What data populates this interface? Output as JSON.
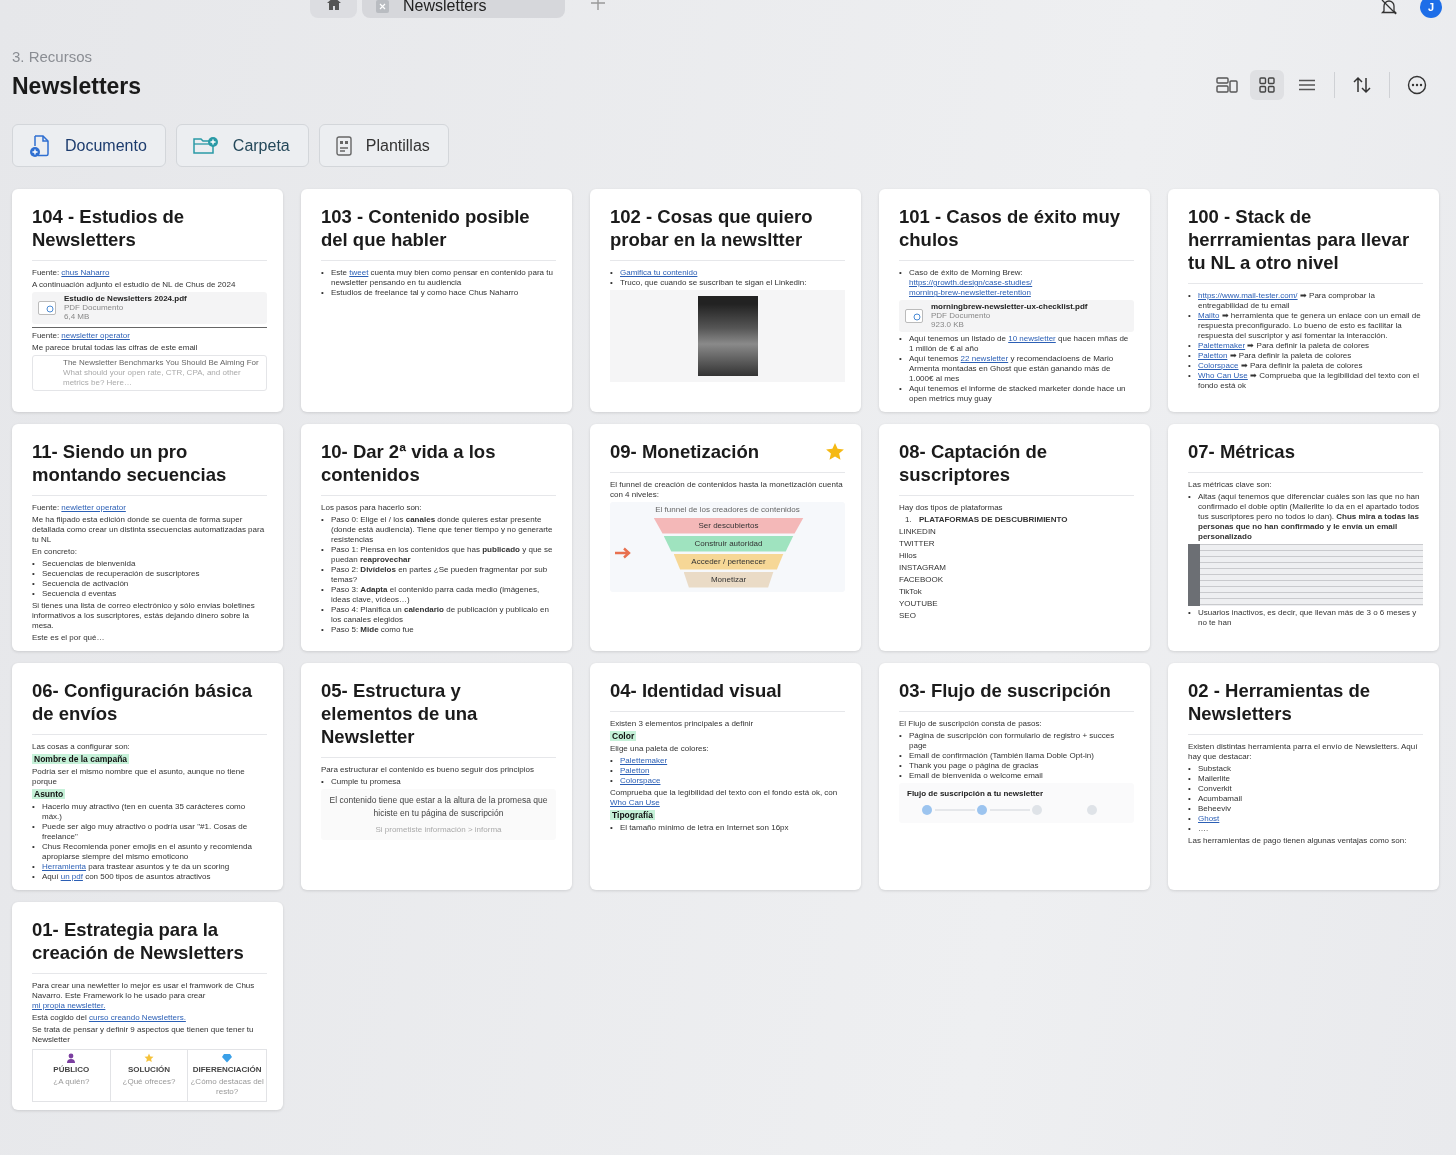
{
  "tabs": [
    {
      "label": "Newsletters",
      "selected": true
    }
  ],
  "avatar": {
    "initial": "J"
  },
  "breadcrumb": "3. Recursos",
  "title": "Newsletters",
  "view_modes": [
    {
      "kind": "gallery",
      "selected": false
    },
    {
      "kind": "grid",
      "selected": true
    },
    {
      "kind": "list",
      "selected": false
    }
  ],
  "actions": [
    {
      "kind": "document",
      "label": "Documento"
    },
    {
      "kind": "folder",
      "label": "Carpeta"
    },
    {
      "kind": "template",
      "label": "Plantillas"
    }
  ],
  "cards": [
    {
      "title": "104 - Estudios de Newsletters",
      "starred": false,
      "blocks": [
        {
          "kind": "p",
          "parts": [
            "Fuente: ",
            {
              "link": "chus Naharro"
            }
          ]
        },
        {
          "kind": "p",
          "parts": [
            "A continuación adjunto el estudio de NL de Chus de 2024"
          ]
        },
        {
          "kind": "file",
          "name": "Estudio de Newsletters 2024.pdf",
          "type": "PDF Documento",
          "size": "6,4 MB"
        },
        {
          "kind": "rule"
        },
        {
          "kind": "p",
          "parts": [
            "Fuente: ",
            {
              "link": "newsletter operator"
            }
          ]
        },
        {
          "kind": "p",
          "parts": [
            "Me parece brutal todas las cifras de este email"
          ]
        },
        {
          "kind": "bookmark",
          "title": "The Newsletter Benchmarks You Should Be Aiming For",
          "desc": "What should your open rate, CTR, CPA, and other metrics be? Here…"
        }
      ]
    },
    {
      "title": "103 - Contenido posible del que habler",
      "starred": false,
      "blocks": [
        {
          "kind": "bullets",
          "marker": "•",
          "items": [
            [
              "Este ",
              {
                "link": "tweet"
              },
              " cuenta muy bien como pensar en contenido para tu newsletter pensando en tu audiencia"
            ],
            [
              "Estudios de freelance tal y como hace Chus Naharro"
            ]
          ]
        }
      ]
    },
    {
      "title": "102 - Cosas que quiero probar en la newsltter",
      "starred": false,
      "blocks": [
        {
          "kind": "bullets",
          "marker": "•",
          "items": [
            [
              {
                "link": "Gamifica tu contenido"
              }
            ],
            [
              "Truco, que cuando se suscriban te sigan el Linkedin:"
            ]
          ]
        },
        {
          "kind": "phone_image"
        }
      ]
    },
    {
      "title": "101 - Casos de éxito muy chulos",
      "starred": false,
      "blocks": [
        {
          "kind": "bullets",
          "marker": "•",
          "items": [
            [
              "Caso de éxito de Morning Brew: ",
              {
                "link": "https://growth.design/case-studies/"
              },
              {
                "link": "morning-brew-newsletter-retention"
              }
            ]
          ]
        },
        {
          "kind": "file",
          "name": "morningbrew-newsletter-ux-checklist.pdf",
          "type": "PDF Documento",
          "size": "923.0 KB"
        },
        {
          "kind": "bullets",
          "marker": "•",
          "items": [
            [
              "Aquí tenemos un listado de ",
              {
                "link": "10 newsletter"
              },
              " que hacen mñas de 1 millón de € al año"
            ],
            [
              "Aquí tenemos ",
              {
                "link": "22 newsletter"
              },
              " y recomendacioens de Mario Armenta montadas en Ghost que están ganando más de 1.000€ al mes"
            ],
            [
              "Aquí tenemos el informe de stacked marketer donde hace un open metrics muy guay"
            ]
          ]
        }
      ]
    },
    {
      "title": "100 - Stack de herrramientas para llevar tu NL a otro nivel",
      "starred": false,
      "blocks": [
        {
          "kind": "bullets",
          "marker": "•",
          "items": [
            [
              {
                "link": "https://www.mail-tester.com/"
              },
              " ➡ Para comprobar la entregabilidad de tu email"
            ],
            [
              {
                "link": "Mailto"
              },
              " ➡ herramienta que te genera un enlace con un email de respuesta preconfigurado. Lo bueno de esto es facilitar la respuesta del suscriptor y así fomentar la interacción."
            ],
            [
              {
                "link": "Palettemaker"
              },
              " ➡ Para definir la paleta de colores"
            ],
            [
              {
                "link": "Paletton"
              },
              " ➡ Para definir la paleta de colores"
            ],
            [
              {
                "link": "Colorspace"
              },
              " ➡ Para definir la paleta de colores"
            ],
            [
              {
                "link": "Who Can Use"
              },
              " ➡ Comprueba que la legibilidad del texto con el fondo está ok"
            ]
          ]
        }
      ]
    },
    {
      "title": "11- Siendo un pro montando secuencias",
      "starred": false,
      "blocks": [
        {
          "kind": "p",
          "parts": [
            "Fuente: ",
            {
              "link": "newletter operator"
            }
          ]
        },
        {
          "kind": "p",
          "parts": [
            "Me ha flipado esta edición donde se cuenta de forma super detallada como crear un distinta ssecuencias automatizadas para tu NL"
          ]
        },
        {
          "kind": "p",
          "parts": [
            "En concreto:"
          ]
        },
        {
          "kind": "bullets",
          "marker": "•",
          "items": [
            [
              "Secuencias de bienvenida"
            ],
            [
              "Secuencias de recuperación de suscriptores"
            ],
            [
              "Secuencia de activación"
            ],
            [
              "Secuencia d eventas"
            ]
          ]
        },
        {
          "kind": "p",
          "parts": [
            "Si tienes una lista de correo electrónico y sólo envías boletines informativos a los suscriptores, estás dejando dinero sobre la mesa."
          ]
        },
        {
          "kind": "p",
          "parts": [
            "Este es el por qué…"
          ]
        }
      ]
    },
    {
      "title": "10- Dar 2ª vida a los contenidos",
      "starred": false,
      "blocks": [
        {
          "kind": "p",
          "parts": [
            "Los pasos para hacerlo son:"
          ]
        },
        {
          "kind": "bullets",
          "marker": "•",
          "items": [
            [
              "Paso 0: Elige el / los ",
              {
                "bold": "canales"
              },
              " donde quieres estar presente (donde está audiencia). Tiene que tener tiempo y no generarte resistencias"
            ],
            [
              "Paso 1: Piensa en los contenidos que has ",
              {
                "bold": "publicado"
              },
              " y que se puedan ",
              {
                "bold": "reaprovechar"
              }
            ],
            [
              "Paso 2: ",
              {
                "bold": "Divídelos"
              },
              " en partes ¿Se pueden fragmentar por sub temas?"
            ],
            [
              "Paso 3: ",
              {
                "bold": "Adapta"
              },
              " el contenido parra cada medio (imágenes, ideas clave, vídeos…)"
            ],
            [
              "Paso 4: Planifica un ",
              {
                "bold": "calendario"
              },
              " de publicación y publícalo en los canales elegidos"
            ],
            [
              "Paso 5: ",
              {
                "bold": "Mide"
              },
              " como fue"
            ]
          ]
        }
      ]
    },
    {
      "title": "09- Monetización",
      "starred": true,
      "blocks": [
        {
          "kind": "p",
          "parts": [
            "El funnel de creación de contenidos hasta la monetización  cuenta con 4 niveles:"
          ]
        },
        {
          "kind": "funnel",
          "title": "El funnel de los creadores de contenidos",
          "stages": [
            {
              "label": "Ser descubiertos",
              "color": "#f4b8b8"
            },
            {
              "label": "Construir autoridad",
              "color": "#9fe3bf"
            },
            {
              "label": "Acceder / pertenecer",
              "color": "#f6d796"
            },
            {
              "label": "Monetizar",
              "color": "#eadbc6"
            }
          ]
        }
      ]
    },
    {
      "title": "08- Captación de suscriptores",
      "starred": false,
      "blocks": [
        {
          "kind": "p",
          "parts": [
            "Hay dos tipos de plataformas"
          ]
        },
        {
          "kind": "numbered",
          "items": [
            {
              "number": "1.",
              "parts": [
                {
                  "bold": "PLATAFORMAS DE DESCUBRIMIENTO"
                }
              ]
            }
          ]
        },
        {
          "kind": "p",
          "parts": [
            "LINKEDIN"
          ]
        },
        {
          "kind": "p",
          "parts": [
            "TWITTER"
          ]
        },
        {
          "kind": "p",
          "parts": [
            "Hilos"
          ]
        },
        {
          "kind": "p",
          "parts": [
            "INSTAGRAM"
          ]
        },
        {
          "kind": "p",
          "parts": [
            "FACEBOOK"
          ]
        },
        {
          "kind": "p",
          "parts": [
            "TikTok"
          ]
        },
        {
          "kind": "p",
          "parts": [
            "YOUTUBE"
          ]
        },
        {
          "kind": "p",
          "parts": [
            "SEO"
          ]
        }
      ]
    },
    {
      "title": "07- Métricas",
      "starred": false,
      "blocks": [
        {
          "kind": "p",
          "parts": [
            "Las métricas clave son:"
          ]
        },
        {
          "kind": "bullets",
          "marker": "•",
          "items": [
            [
              "Altas (aquí tenemos que diferenciar cuáles son las que no han confirmado el doble optin (Mailerlite lo da en el apartado todos tus suscriptores pero no todos lo dan). ",
              {
                "bold": "Chus mira a todas las personas que no han confirmado y le envía un email personalizado"
              }
            ]
          ]
        },
        {
          "kind": "screen_image"
        },
        {
          "kind": "bullets",
          "marker": "•",
          "items": [
            [
              "Usuarios inactivos, es decir, que llevan más de 3 o 6 meses y no te han"
            ]
          ]
        }
      ]
    },
    {
      "title": "06- Configuración básica de envíos",
      "starred": false,
      "blocks": [
        {
          "kind": "p",
          "parts": [
            "Las cosas a configurar son:"
          ]
        },
        {
          "kind": "tag",
          "text": "Nombre de la campaña"
        },
        {
          "kind": "p",
          "parts": [
            "Podría ser el mismo nombre que el asunto, aunque no tiene porque"
          ]
        },
        {
          "kind": "tag",
          "text": "Asunto"
        },
        {
          "kind": "bullets",
          "marker": "•",
          "items": [
            [
              "Hacerlo muy atractivo (ten en cuenta 35 carácteres como máx.)"
            ],
            [
              "Puede ser algo muy atractivo o podría usar \"#1. Cosas de freelance\""
            ],
            [
              "Chus Recomienda poner emojis en el asunto y recomienda apropiarse siempre del mismo emoticono"
            ],
            [
              {
                "link": "Herramienta"
              },
              " para trastear asuntos y te da un scoring"
            ],
            [
              "Aquí ",
              {
                "link": "un pdf"
              },
              " con 500 tipos de asuntos atractivos"
            ]
          ]
        }
      ]
    },
    {
      "title": "05- Estructura y elementos de una Newsletter",
      "starred": false,
      "blocks": [
        {
          "kind": "p",
          "parts": [
            "Para estructurar el contenido es bueno seguir dos principios"
          ]
        },
        {
          "kind": "bullets",
          "marker": "•",
          "items": [
            [
              "Cumple tu promesa"
            ]
          ]
        },
        {
          "kind": "quote",
          "lines": [
            "El contenido tiene que estar a la altura de la promesa que hiciste en tu página de suscripción",
            "Si prometiste información > informa"
          ]
        }
      ]
    },
    {
      "title": "04- Identidad visual",
      "starred": false,
      "blocks": [
        {
          "kind": "p",
          "parts": [
            "Existen 3 elementos principales a definir"
          ]
        },
        {
          "kind": "tag",
          "text": "Color"
        },
        {
          "kind": "p",
          "parts": [
            "Elige una paleta de colores:"
          ]
        },
        {
          "kind": "bullets",
          "marker": "•",
          "items": [
            [
              {
                "link": "Palettemaker"
              }
            ],
            [
              {
                "link": "Paletton"
              }
            ],
            [
              {
                "link": "Colorspace"
              }
            ]
          ]
        },
        {
          "kind": "p",
          "parts": [
            "Comprueba que la legibilidad del texto con el fondo está ok, con ",
            {
              "link": "Who Can Use"
            }
          ]
        },
        {
          "kind": "tag",
          "text": "Tipografía"
        },
        {
          "kind": "bullets",
          "marker": "•",
          "items": [
            [
              "El tamaño mínimo de letra en Internet son 16px"
            ]
          ]
        }
      ]
    },
    {
      "title": "03- Flujo de suscripción",
      "starred": false,
      "blocks": [
        {
          "kind": "p",
          "parts": [
            "El Flujo de suscripción consta de  pasos:"
          ]
        },
        {
          "kind": "bullets",
          "marker": "•",
          "items": [
            [
              "Página de suscripción con formulario de registro + succes page"
            ],
            [
              "Email de confirmación (También llama Doble Opt-in)"
            ],
            [
              "Thank you page o página de gracias"
            ],
            [
              "Email de bienvenida o welcome email"
            ]
          ]
        },
        {
          "kind": "diagram",
          "title": "Flujo de suscripción a tu newsletter"
        }
      ]
    },
    {
      "title": "02 - Herramientas de Newsletters",
      "starred": false,
      "blocks": [
        {
          "kind": "p",
          "parts": [
            "Existen distintas herramienta parra el envío de Newsletters. Aquí hay que destacar:"
          ]
        },
        {
          "kind": "bullets",
          "marker": "•",
          "items": [
            [
              "Substack"
            ],
            [
              "Mailerlite"
            ],
            [
              "Converkit"
            ],
            [
              "Acumbamail"
            ],
            [
              "Beheeviv"
            ],
            [
              {
                "link": "Ghost"
              }
            ],
            [
              "…."
            ]
          ]
        },
        {
          "kind": "p",
          "parts": [
            "Las herramientas de pago tienen algunas ventajas como son:"
          ]
        }
      ]
    },
    {
      "title": "01- Estrategia para la creación de Newsletters",
      "starred": false,
      "blocks": [
        {
          "kind": "p",
          "parts": [
            "Para crear una newletter lo mejor es usar el framwork de Chus Navarro. Este Framework lo he usado para crear ",
            {
              "link": "mi propia newsletter."
            }
          ]
        },
        {
          "kind": "p",
          "parts": [
            "Está cogido del ",
            {
              "link": "curso creando Newsletters."
            }
          ]
        },
        {
          "kind": "p",
          "parts": [
            "Se trata de pensar y definir 9 aspectos que tienen que tener tu Newsletter"
          ]
        },
        {
          "kind": "aspects",
          "items": [
            {
              "label": "PÚBLICO",
              "hint": "¿A quién?"
            },
            {
              "label": "SOLUCIÓN",
              "hint": "¿Qué ofreces?"
            },
            {
              "label": "DIFERENCIACIÓN",
              "hint": "¿Cómo destacas del resto?"
            }
          ]
        }
      ]
    }
  ]
}
